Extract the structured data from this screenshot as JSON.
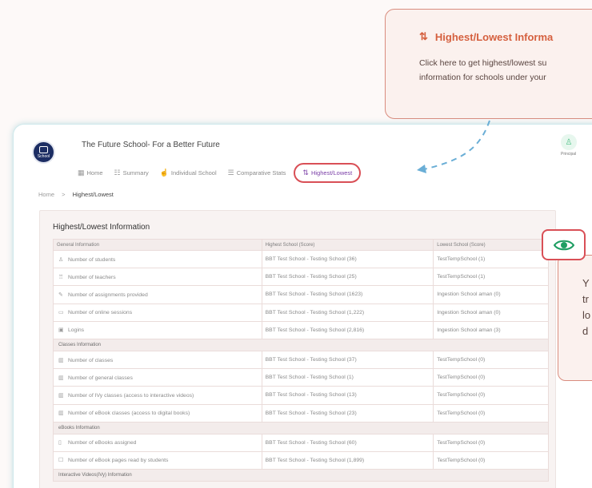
{
  "tooltip_top": {
    "icon": "sort-arrows-icon",
    "title": "Highest/Lowest Informa",
    "body_line1": "Click here to get highest/lowest su",
    "body_line2": "information for schools under your"
  },
  "header": {
    "school_title": "The Future School- For a Better Future",
    "logo_text": "School",
    "role": "Principal"
  },
  "nav": {
    "items": [
      {
        "label": "Home",
        "icon": "grid-icon"
      },
      {
        "label": "Summary",
        "icon": "summary-icon"
      },
      {
        "label": "Individual School",
        "icon": "thumbs-up-icon"
      },
      {
        "label": "Comparative Stats",
        "icon": "stats-icon"
      },
      {
        "label": "Highest/Lowest",
        "icon": "sort-arrows-icon"
      }
    ],
    "active": "Highest/Lowest"
  },
  "breadcrumb": {
    "home": "Home",
    "separator": ">",
    "current": "Highest/Lowest"
  },
  "card": {
    "title": "Highest/Lowest Information",
    "headers": [
      "General Information",
      "Highest School (Score)",
      "Lowest School (Score)"
    ],
    "rows": [
      {
        "type": "row",
        "icon": "student-icon",
        "c1": "Number of students",
        "c2": "BBT Test School - Testing School (36)",
        "c3": "TestTempSchool (1)"
      },
      {
        "type": "row",
        "icon": "teacher-icon",
        "c1": "Number of teachers",
        "c2": "BBT Test School - Testing School (25)",
        "c3": "TestTempSchool (1)"
      },
      {
        "type": "row",
        "icon": "assignment-icon",
        "c1": "Number of assignments provided",
        "c2": "BBT Test School - Testing School (1623)",
        "c3": "Ingestion School aman (0)"
      },
      {
        "type": "row",
        "icon": "online-session-icon",
        "c1": "Number of online sessions",
        "c2": "BBT Test School - Testing School (1,222)",
        "c3": "Ingestion School aman (0)"
      },
      {
        "type": "row",
        "icon": "login-icon",
        "c1": "Logins",
        "c2": "BBT Test School - Testing School (2,816)",
        "c3": "Ingestion School aman (3)"
      },
      {
        "type": "section",
        "c1": "Classes Information"
      },
      {
        "type": "row",
        "icon": "class-icon",
        "c1": "Number of classes",
        "c2": "BBT Test School - Testing School (37)",
        "c3": "TestTempSchool (0)"
      },
      {
        "type": "row",
        "icon": "class-icon",
        "c1": "Number of general classes",
        "c2": "BBT Test School - Testing School (1)",
        "c3": "TestTempSchool (0)"
      },
      {
        "type": "row",
        "icon": "class-icon",
        "c1": "Number of IVy classes (access to interactive videos)",
        "c2": "BBT Test School - Testing School (13)",
        "c3": "TestTempSchool (0)"
      },
      {
        "type": "row",
        "icon": "class-icon",
        "c1": "Number of eBook classes (access to digital books)",
        "c2": "BBT Test School - Testing School (23)",
        "c3": "TestTempSchool (0)"
      },
      {
        "type": "section",
        "c1": "eBooks Information"
      },
      {
        "type": "row",
        "icon": "book-icon",
        "c1": "Number of eBooks assigned",
        "c2": "BBT Test School - Testing School (60)",
        "c3": "TestTempSchool (0)"
      },
      {
        "type": "row",
        "icon": "pages-icon",
        "c1": "Number of eBook pages read by students",
        "c2": "BBT Test School - Testing School (1,899)",
        "c3": "TestTempSchool (0)"
      },
      {
        "type": "section",
        "c1": "Interactive Videos(IVy) Information"
      }
    ]
  },
  "eye_button": {
    "icon": "eye-icon"
  },
  "tooltip_right": {
    "text": "Y\ntr\nlo\nd"
  },
  "colors": {
    "accent": "#d5603f",
    "highlight_border": "#d94f56",
    "active_nav": "#7b3fa7",
    "eye_green": "#1f9e63",
    "arrow_blue": "#6aaed6"
  }
}
